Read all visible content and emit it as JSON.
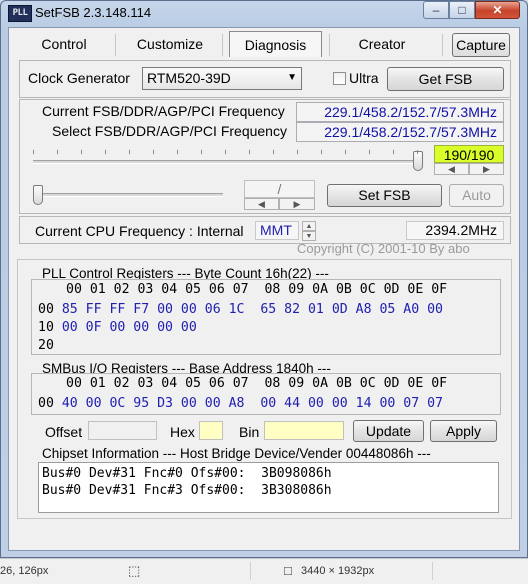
{
  "window": {
    "app_icon": "PLL",
    "title": "SetFSB 2.3.148.114",
    "controls": {
      "minimize": "–",
      "maximize": "□",
      "close": "✕"
    }
  },
  "tabs": [
    {
      "label": "Control"
    },
    {
      "label": "Customize"
    },
    {
      "label": "Diagnosis",
      "selected": true
    },
    {
      "label": "Creator"
    }
  ],
  "capture_label": "Capture",
  "clock": {
    "label": "Clock Generator",
    "selected": "RTM520-39D",
    "ultra_label": "Ultra",
    "ultra_checked": false,
    "get_fsb_label": "Get FSB"
  },
  "freq": {
    "current_label": "Current FSB/DDR/AGP/PCI Frequency",
    "current_value": "229.1/458.2/152.7/57.3MHz",
    "select_label": "Select FSB/DDR/AGP/PCI Frequency",
    "select_value": "229.1/458.2/152.7/57.3MHz",
    "slider_readout": "190/190",
    "slider_level": 1.0,
    "ratio_sep": "/",
    "set_fsb_label": "Set FSB",
    "auto_label": "Auto"
  },
  "cpu": {
    "label": "Current CPU Frequency : Internal",
    "mode": "MMT",
    "value": "2394.2MHz",
    "copyright": "Copyright (C) 2001-10 By abo"
  },
  "pll": {
    "title": "PLL Control Registers  --- Byte Count 16h(22) ---",
    "header": "00 01 02 03 04 05 06 07  08 09 0A 0B 0C 0D 0E 0F",
    "rows": [
      {
        "addr": "00",
        "b1": "85 FF FF F7 00 00 06 1C",
        "b2": "65 82 01 0D A8 05 A0 00"
      },
      {
        "addr": "10",
        "b1": "00 0F 00 00 00 00",
        "b2": ""
      },
      {
        "addr": "20",
        "b1": "",
        "b2": ""
      }
    ]
  },
  "smbus": {
    "title": "SMBus I/O Registers  --- Base Address 1840h ---",
    "header": "00 01 02 03 04 05 06 07  08 09 0A 0B 0C 0D 0E 0F",
    "rows": [
      {
        "addr": "00",
        "b1": "40 00 0C 95 D3 00 00 A8",
        "b2": "00 44 00 00 14 00 07 07"
      }
    ]
  },
  "io": {
    "offset_label": "Offset",
    "offset_value": "",
    "hex_label": "Hex",
    "hex_value": "",
    "bin_label": "Bin",
    "bin_value": "",
    "update_label": "Update",
    "apply_label": "Apply"
  },
  "chipset": {
    "title": "Chipset Information  --- Host Bridge Device/Vender 00448086h ---",
    "lines": [
      "Bus#0 Dev#31 Fnc#0 Ofs#00:  3B098086h",
      "Bus#0 Dev#31 Fnc#3 Ofs#00:  3B308086h"
    ]
  },
  "statusbar": {
    "cursor": "26, 126px",
    "dimensions": "3440 × 1932px",
    "icons": [
      "cursor-icon",
      "selection-icon",
      "dimensions-icon"
    ]
  },
  "colors": {
    "readout_green": "#d8ff2a",
    "value_blue": "#2020b0",
    "input_yellow": "#ffffc4"
  }
}
